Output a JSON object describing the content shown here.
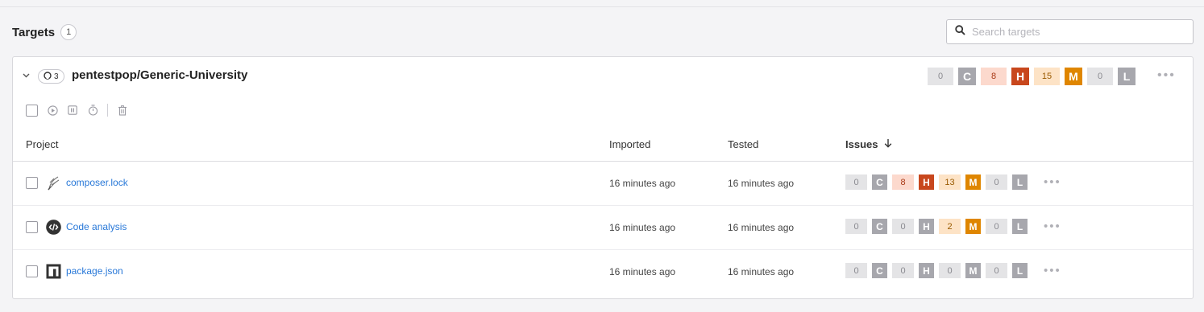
{
  "header": {
    "title": "Targets",
    "count": "1"
  },
  "search": {
    "placeholder": "Search targets",
    "icon": "search-icon"
  },
  "target": {
    "repo_count": "3",
    "name": "pentestpop/Generic-University",
    "severity": [
      {
        "count": "0",
        "letter": "C"
      },
      {
        "count": "8",
        "letter": "H"
      },
      {
        "count": "15",
        "letter": "M"
      },
      {
        "count": "0",
        "letter": "L"
      }
    ],
    "more": "•••"
  },
  "columns": {
    "project": "Project",
    "imported": "Imported",
    "tested": "Tested",
    "issues": "Issues"
  },
  "rows": [
    {
      "name": "composer.lock",
      "icon": "composer-icon",
      "imported": "16 minutes ago",
      "tested": "16 minutes ago",
      "severity": [
        {
          "count": "0",
          "letter": "C"
        },
        {
          "count": "8",
          "letter": "H"
        },
        {
          "count": "13",
          "letter": "M"
        },
        {
          "count": "0",
          "letter": "L"
        }
      ],
      "more": "•••"
    },
    {
      "name": "Code analysis",
      "icon": "code-icon",
      "imported": "16 minutes ago",
      "tested": "16 minutes ago",
      "severity": [
        {
          "count": "0",
          "letter": "C"
        },
        {
          "count": "0",
          "letter": "H"
        },
        {
          "count": "2",
          "letter": "M"
        },
        {
          "count": "0",
          "letter": "L"
        }
      ],
      "more": "•••"
    },
    {
      "name": "package.json",
      "icon": "npm-icon",
      "imported": "16 minutes ago",
      "tested": "16 minutes ago",
      "severity": [
        {
          "count": "0",
          "letter": "C"
        },
        {
          "count": "0",
          "letter": "H"
        },
        {
          "count": "0",
          "letter": "M"
        },
        {
          "count": "0",
          "letter": "L"
        }
      ],
      "more": "•••"
    }
  ],
  "colors": {
    "link": "#2878d8",
    "high": "#c8471d",
    "high_bg": "#fcd9cd",
    "medium": "#df8600",
    "medium_bg": "#fde3c6",
    "zero_letter": "#a7a7ad",
    "zero_bg": "#e4e4e6"
  }
}
